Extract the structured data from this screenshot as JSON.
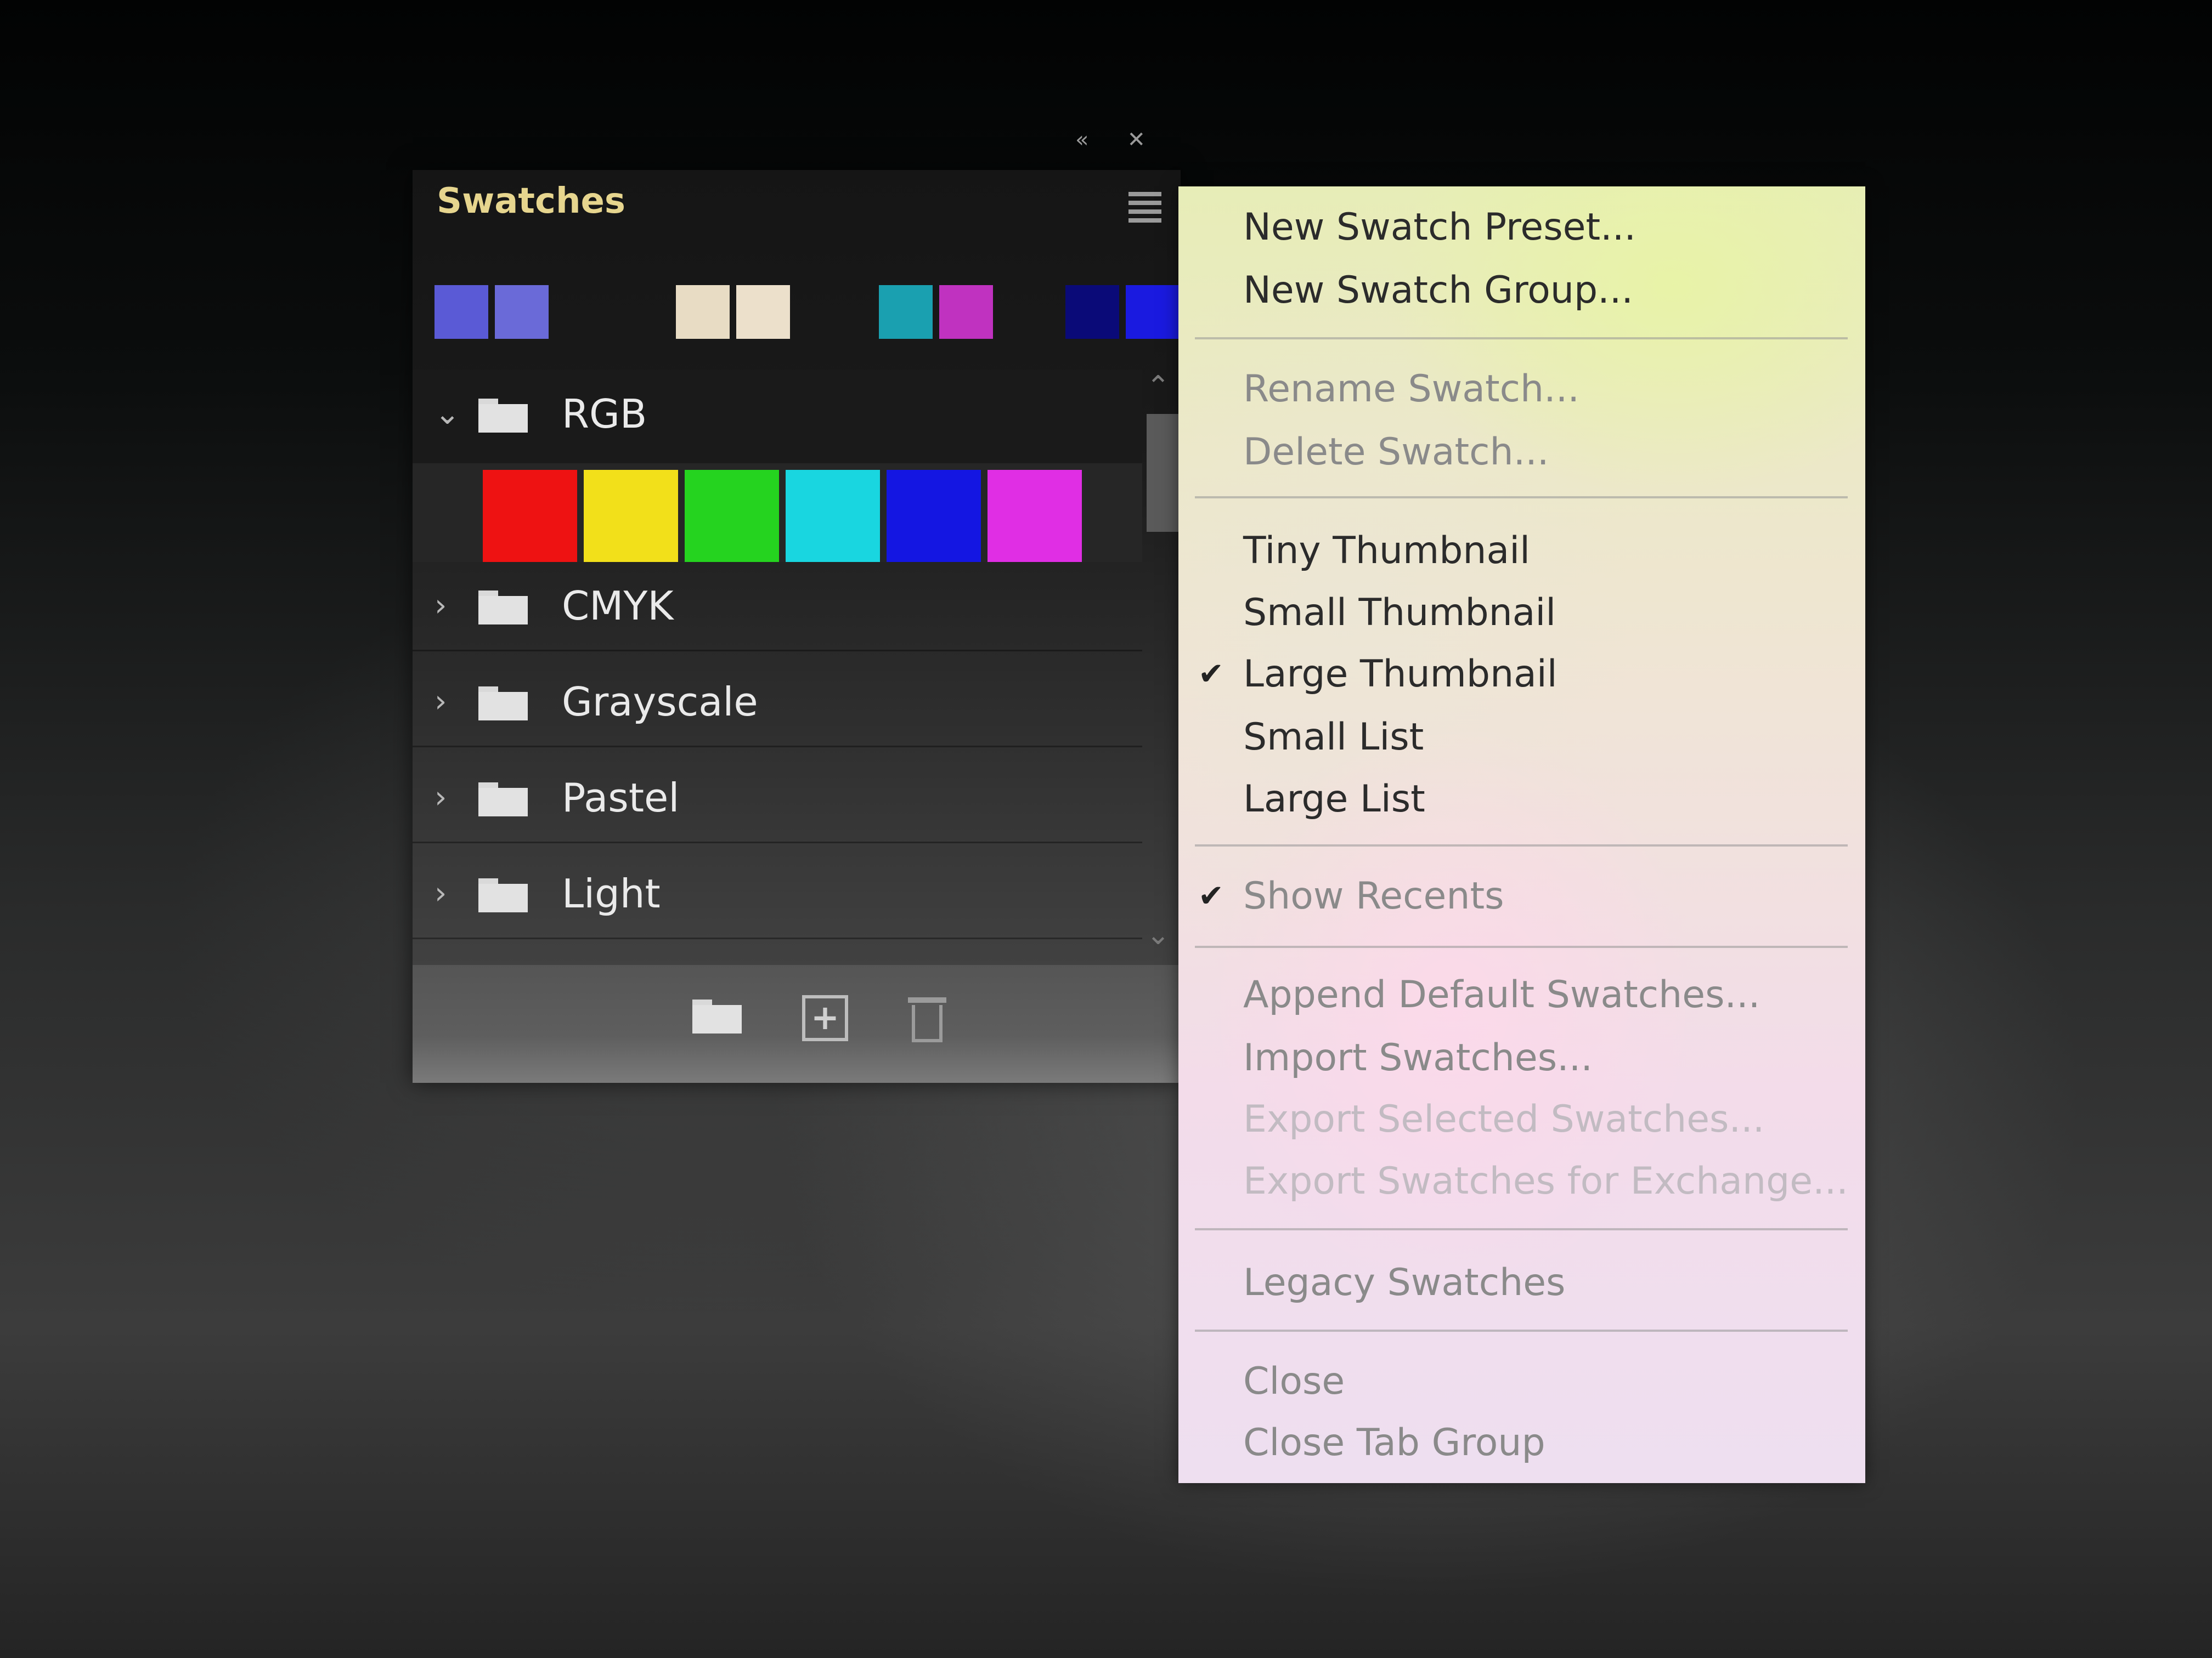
{
  "dock": {
    "collapse_icon": "«",
    "close_icon": "✕"
  },
  "panel": {
    "title": "Swatches",
    "recent_swatches": [
      {
        "color": "#5a5ad6"
      },
      {
        "color": "#6a6ad8"
      },
      {
        "color": "#e8dcc4"
      },
      {
        "color": "#ece0cb"
      },
      {
        "color": "#1aa0b0"
      },
      {
        "color": "#c032c0"
      },
      {
        "color": "#0a0a78"
      },
      {
        "color": "#1a1ae0"
      }
    ],
    "groups": [
      {
        "label": "RGB",
        "expanded": true
      },
      {
        "label": "CMYK",
        "expanded": false
      },
      {
        "label": "Grayscale",
        "expanded": false
      },
      {
        "label": "Pastel",
        "expanded": false
      },
      {
        "label": "Light",
        "expanded": false
      }
    ],
    "rgb_swatches": [
      {
        "color": "#ee1212"
      },
      {
        "color": "#f2e01a"
      },
      {
        "color": "#25d31f"
      },
      {
        "color": "#19d6e0"
      },
      {
        "color": "#1416e2"
      },
      {
        "color": "#e02ee4"
      }
    ],
    "expanded_chevron": "⌄",
    "collapsed_chevron": "›",
    "scroll_up": "⌃",
    "scroll_down": "⌄",
    "plus": "+"
  },
  "menu": {
    "check": "✔",
    "items": [
      {
        "label": "New Swatch Preset...",
        "state": "enabled",
        "checked": false
      },
      {
        "label": "New Swatch Group...",
        "state": "enabled",
        "checked": false
      },
      {
        "label": "Rename Swatch...",
        "state": "dim",
        "checked": false
      },
      {
        "label": "Delete Swatch...",
        "state": "dim",
        "checked": false
      },
      {
        "label": "Tiny Thumbnail",
        "state": "enabled",
        "checked": false
      },
      {
        "label": "Small Thumbnail",
        "state": "enabled",
        "checked": false
      },
      {
        "label": "Large Thumbnail",
        "state": "enabled",
        "checked": true
      },
      {
        "label": "Small List",
        "state": "enabled",
        "checked": false
      },
      {
        "label": "Large List",
        "state": "enabled",
        "checked": false
      },
      {
        "label": "Show Recents",
        "state": "dim",
        "checked": true
      },
      {
        "label": "Append Default Swatches...",
        "state": "dim",
        "checked": false
      },
      {
        "label": "Import Swatches...",
        "state": "dim",
        "checked": false
      },
      {
        "label": "Export Selected Swatches...",
        "state": "disabled",
        "checked": false
      },
      {
        "label": "Export Swatches for Exchange...",
        "state": "disabled",
        "checked": false
      },
      {
        "label": "Legacy Swatches",
        "state": "dim",
        "checked": false
      },
      {
        "label": "Close",
        "state": "dim",
        "checked": false
      },
      {
        "label": "Close Tab Group",
        "state": "dim",
        "checked": false
      }
    ]
  }
}
